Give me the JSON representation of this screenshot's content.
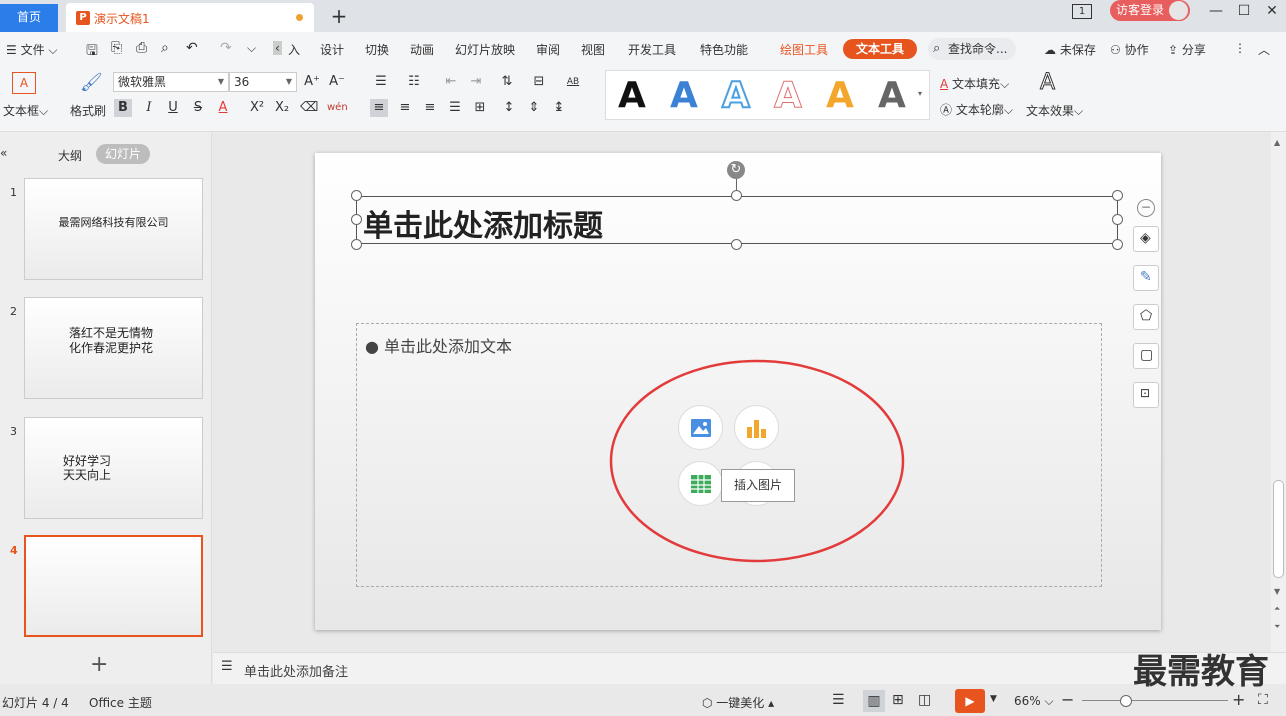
{
  "titlebar": {
    "home_tab": "首页",
    "doc_tab": "演示文稿1",
    "doc_icon": "P",
    "page_count": "1",
    "guest_login": "访客登录"
  },
  "menu": {
    "file": "文件",
    "insert": "入",
    "items": [
      "设计",
      "切换",
      "动画",
      "幻灯片放映",
      "审阅",
      "视图",
      "开发工具",
      "特色功能"
    ],
    "draw_tool": "绘图工具",
    "text_tool": "文本工具",
    "search": "查找命令...",
    "unsaved": "未保存",
    "collaborate": "协作",
    "share": "分享"
  },
  "ribbon": {
    "textbox": "文本框",
    "format_painter": "格式刷",
    "font_name": "微软雅黑",
    "font_size": "36",
    "text_fill": "文本填充",
    "text_outline": "文本轮廓",
    "text_effect": "文本效果",
    "wordart_letter": "A"
  },
  "panel": {
    "outline_tab": "大纲",
    "slides_tab": "幻灯片",
    "slides": [
      {
        "num": "1",
        "lines": [
          "最需网络科技有限公司"
        ]
      },
      {
        "num": "2",
        "lines": [
          "落红不是无情物",
          "化作春泥更护花"
        ]
      },
      {
        "num": "3",
        "lines": [
          "好好学习",
          "天天向上"
        ]
      },
      {
        "num": "4",
        "lines": []
      }
    ]
  },
  "slide": {
    "title_placeholder": "单击此处添加标题",
    "body_placeholder": "单击此处添加文本",
    "tooltip": "插入图片"
  },
  "notes": {
    "placeholder": "单击此处添加备注"
  },
  "status": {
    "slide_info": "幻灯片 4 / 4",
    "theme": "Office 主题",
    "beautify": "一键美化",
    "zoom": "66%"
  },
  "watermark": "最需教育",
  "colors": {
    "accent": "#e8541e",
    "home_blue": "#2b7de9",
    "annotation_red": "#e33b3b"
  }
}
